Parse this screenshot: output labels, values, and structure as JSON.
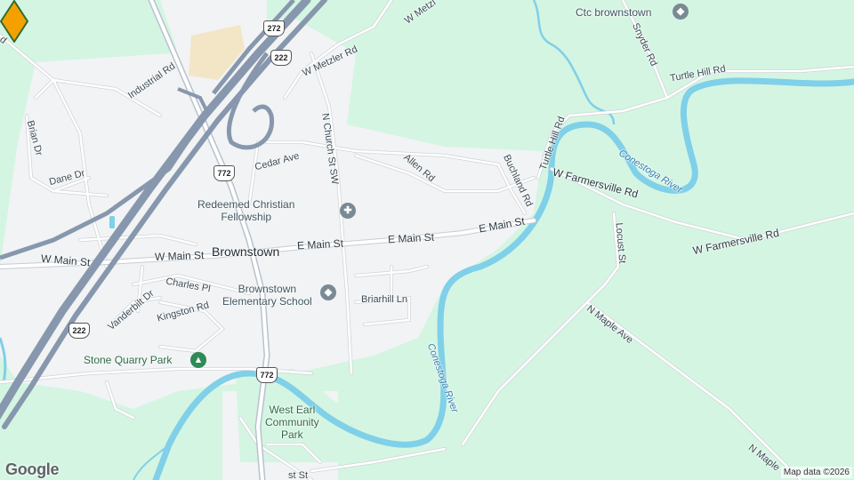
{
  "colors": {
    "land": "#d4f5e2",
    "urban": "#f1f3f4",
    "road": "#ffffff",
    "road_edge": "#d0d4d8",
    "highway": "#8797ad",
    "water": "#7fd0e8",
    "pin": "#f4a100",
    "pin_outline": "#2f6b2f"
  },
  "labels": {
    "town": "Brownstown",
    "w_main_st_left": "W Main St",
    "w_main_st_right": "W Main St",
    "e_main_st_left": "E Main St",
    "e_main_st_mid": "E Main St",
    "e_main_st_right": "E Main St",
    "w_metzler_rd": "W Metzler Rd",
    "w_metzler_top": "W Metzl",
    "industrial_rd": "Industrial Rd",
    "brian_dr": "Brian Dr",
    "dane_dr": "Dane Dr",
    "cedar_ave": "Cedar Ave",
    "n_church_st": "N Church St SW",
    "allen_rd": "Allen Rd",
    "buchland_rd": "Buchland Rd",
    "turtle_hill_rd_v": "Turtle Hill Rd",
    "turtle_hill_rd_h": "Turtle Hill Rd",
    "snyder_rd": "Snyder Rd",
    "w_farmersville_rd_1": "W Farmersville Rd",
    "w_farmersville_rd_2": "W Farmersville Rd",
    "locust_st": "Locust St",
    "n_maple_ave": "N Maple Ave",
    "n_maple_bottom": "N Maple",
    "charles_pl": "Charles Pl",
    "vanderbilt_dr": "Vanderbilt Dr",
    "kingston_rd": "Kingston Rd",
    "briarhill_ln": "Briarhill Ln",
    "conestoga_river_1": "Conestoga River",
    "conestoga_river_2": "Conestoga River",
    "bottom_st": "st St",
    "top_left_rd": "d"
  },
  "pois": {
    "ctc": "Ctc brownstown",
    "church_line1": "Redeemed Christian",
    "church_line2": "Fellowship",
    "school_line1": "Brownstown",
    "school_line2": "Elementary School",
    "stone_quarry": "Stone Quarry Park",
    "west_earl_line1": "West Earl",
    "west_earl_line2": "Community",
    "west_earl_line3": "Park"
  },
  "shields": {
    "us272_top": "272",
    "us222_top": "222",
    "pa772_mid": "772",
    "us222_left": "222",
    "pa772_bottom": "772"
  },
  "icons": {
    "school": "school-icon",
    "church": "church-icon",
    "park": "tree-icon",
    "marker": "location-pin-icon"
  },
  "attribution": {
    "logo": "Google",
    "map_data": "Map data ©2026"
  }
}
